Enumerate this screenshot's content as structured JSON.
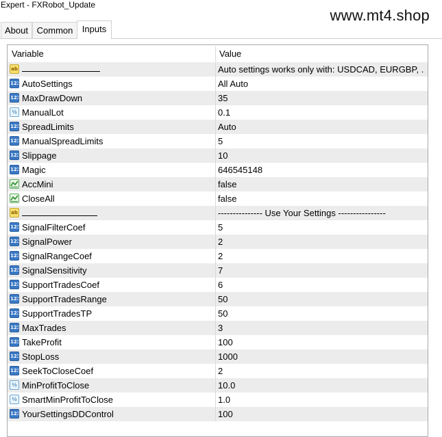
{
  "window": {
    "title": "Expert - FXRobot_Update"
  },
  "watermark": "www.mt4.shop",
  "tabs": [
    {
      "label": "About",
      "active": false
    },
    {
      "label": "Common",
      "active": false
    },
    {
      "label": "Inputs",
      "active": true
    }
  ],
  "table": {
    "headers": {
      "variable": "Variable",
      "value": "Value"
    },
    "rows": [
      {
        "type": "str",
        "name": "",
        "value": "Auto settings works only with: USDCAD, EURGBP, ..."
      },
      {
        "type": "int",
        "name": "AutoSettings",
        "value": "All Auto"
      },
      {
        "type": "int",
        "name": "MaxDrawDown",
        "value": "35"
      },
      {
        "type": "dbl",
        "name": "ManualLot",
        "value": "0.1"
      },
      {
        "type": "int",
        "name": "SpreadLimits",
        "value": "Auto"
      },
      {
        "type": "int",
        "name": "ManualSpreadLimits",
        "value": "5"
      },
      {
        "type": "int",
        "name": "Slippage",
        "value": "10"
      },
      {
        "type": "int",
        "name": "Magic",
        "value": "646545148"
      },
      {
        "type": "bool",
        "name": "AccMini",
        "value": "false"
      },
      {
        "type": "bool",
        "name": "CloseAll",
        "value": "false"
      },
      {
        "type": "str",
        "name": "",
        "value": "---------------  Use Your Settings ----------------"
      },
      {
        "type": "int",
        "name": "SignalFilterCoef",
        "value": "5"
      },
      {
        "type": "int",
        "name": "SignalPower",
        "value": "2"
      },
      {
        "type": "int",
        "name": "SignalRangeCoef",
        "value": "2"
      },
      {
        "type": "int",
        "name": "SignalSensitivity",
        "value": "7"
      },
      {
        "type": "int",
        "name": "SupportTradesCoef",
        "value": "6"
      },
      {
        "type": "int",
        "name": "SupportTradesRange",
        "value": "50"
      },
      {
        "type": "int",
        "name": "SupportTradesTP",
        "value": "50"
      },
      {
        "type": "int",
        "name": "MaxTrades",
        "value": "3"
      },
      {
        "type": "int",
        "name": "TakeProfit",
        "value": "100"
      },
      {
        "type": "int",
        "name": "StopLoss",
        "value": "1000"
      },
      {
        "type": "int",
        "name": "SeekToCloseCoef",
        "value": "2"
      },
      {
        "type": "dbl",
        "name": "MinProfitToClose",
        "value": "10.0"
      },
      {
        "type": "dbl",
        "name": "SmartMinProfitToClose",
        "value": "1.0"
      },
      {
        "type": "int",
        "name": "YourSettingsDDControl",
        "value": "100"
      }
    ]
  },
  "icons": {
    "int": "integer-type-icon",
    "dbl": "double-type-icon",
    "str": "string-type-icon",
    "bool": "boolean-type-icon"
  },
  "icon_glyphs": {
    "int": "123",
    "dbl": "½",
    "str": "ab"
  }
}
